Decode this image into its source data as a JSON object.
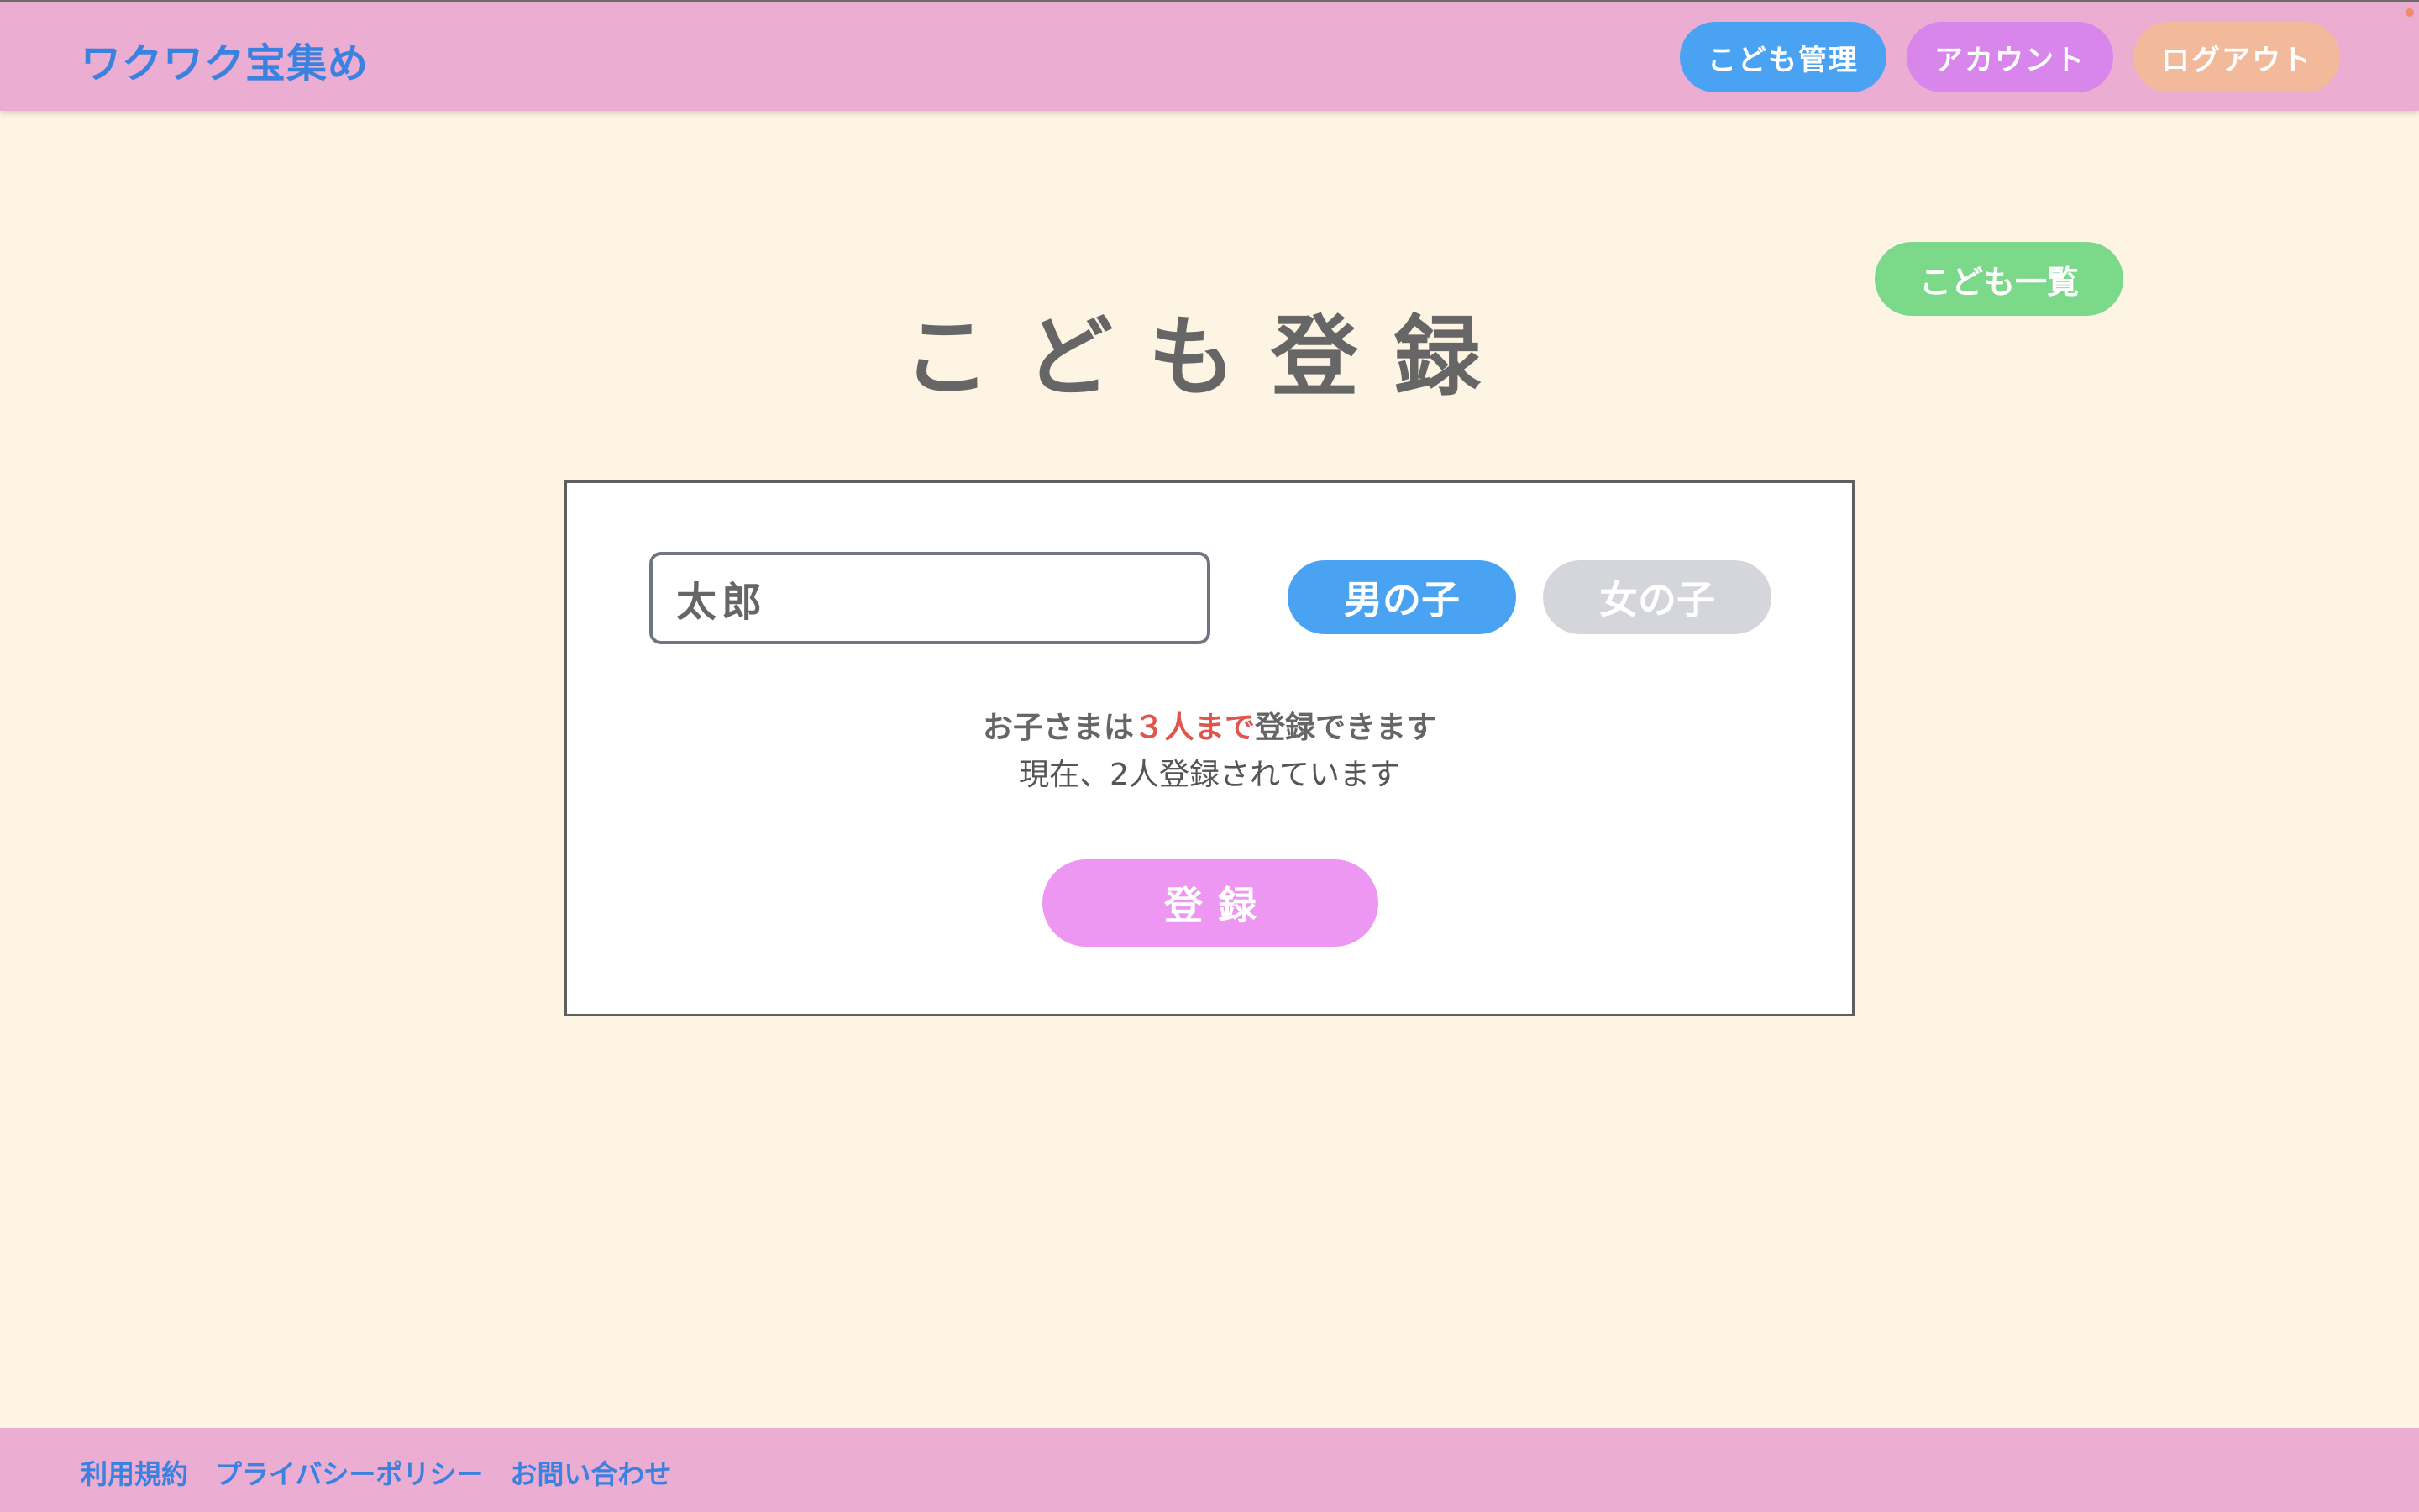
{
  "header": {
    "logo": "ワクワク宝集め",
    "nav": {
      "kids_management": "こども管理",
      "account": "アカウント",
      "logout": "ログアウト"
    }
  },
  "main": {
    "title": "こども登録",
    "list_button": "こども一覧"
  },
  "form": {
    "name_value": "太郎",
    "gender_options": {
      "boy": "男の子",
      "girl": "女の子"
    },
    "selected_gender": "男の子",
    "notice_prefix": "お子さまは",
    "notice_limit": "３人まで",
    "notice_suffix": "登録できます",
    "current_status": "現在、2人登録されています",
    "submit_label": "登録"
  },
  "footer": {
    "links": [
      "利用規約",
      "プライバシーポリシー",
      "お問い合わせ"
    ]
  },
  "colors": {
    "header_bg": "#ebadd2",
    "page_bg": "#fdf4e3",
    "logo": "#3b82e0",
    "kids_button": "#4aa3f2",
    "account_button": "#d885ec",
    "logout_button": "#f3b99b",
    "list_button": "#7cd98a",
    "selected_gender": "#4aa3f2",
    "unselected_gender": "#d4d6dc",
    "submit_button": "#ee97f2",
    "limit_highlight": "#e0554e"
  }
}
